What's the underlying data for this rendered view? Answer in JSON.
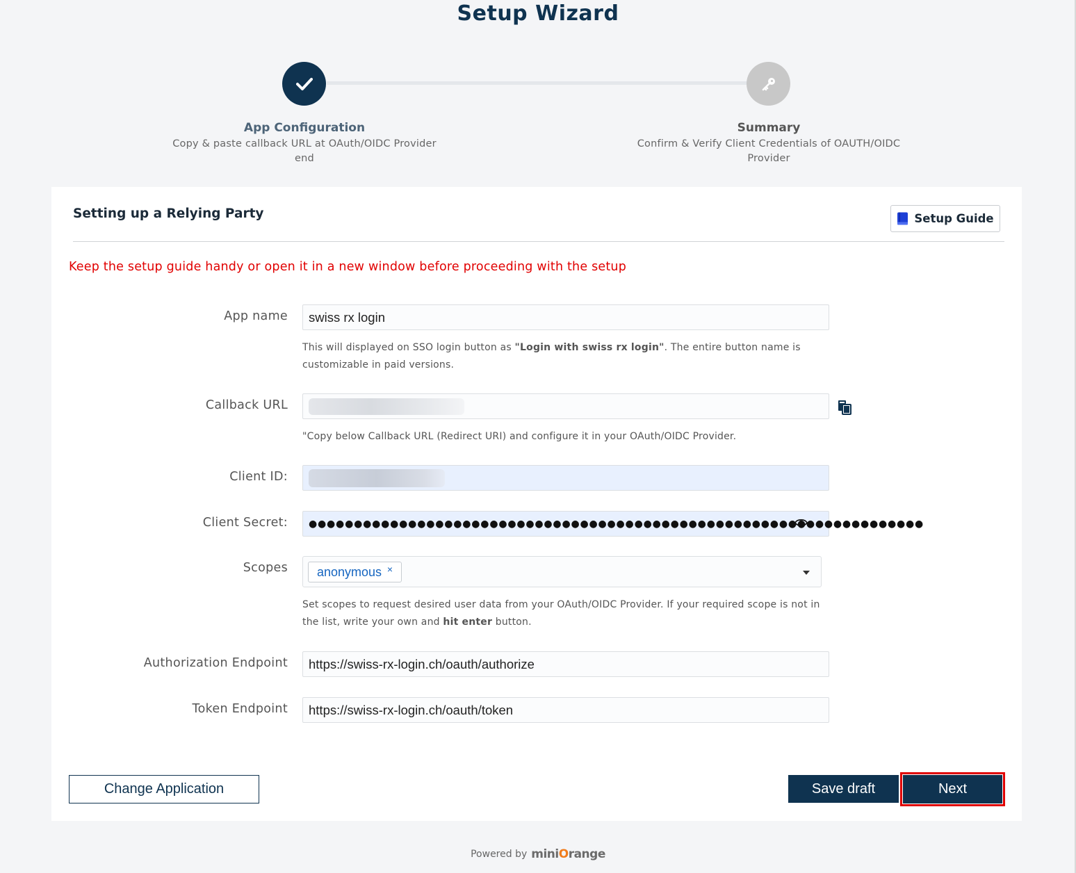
{
  "wizard": {
    "title": "Setup Wizard",
    "steps": [
      {
        "title": "App Configuration",
        "description": "Copy & paste callback URL at OAuth/OIDC Provider end",
        "status": "completed",
        "icon": "check-icon"
      },
      {
        "title": "Summary",
        "description": "Confirm & Verify Client Credentials of OAUTH/OIDC Provider",
        "status": "pending",
        "icon": "key-icon"
      }
    ]
  },
  "card": {
    "heading": "Setting up a Relying Party",
    "setup_guide_label": "Setup Guide",
    "warning": "Keep the setup guide handy or open it in a new window before proceeding with the setup"
  },
  "form": {
    "app_name": {
      "label": "App name",
      "value": "swiss rx login",
      "help_prefix": "This will displayed on SSO login button as ",
      "help_bold": "\"Login with swiss rx login\"",
      "help_suffix": ". The entire button name is customizable in paid versions."
    },
    "callback_url": {
      "label": "Callback URL",
      "help": "\"Copy below Callback URL (Redirect URI) and configure it in your OAuth/OIDC Provider."
    },
    "client_id": {
      "label": "Client ID:"
    },
    "client_secret": {
      "label": "Client Secret:",
      "masked_value": "●●●●●●●●●●●●●●●●●●●●●●●●●●●●●●●●●●●●●●●●●●●●●●●●●●●●●●●●●●●●●●●●●●●●"
    },
    "scopes": {
      "label": "Scopes",
      "selected": [
        "anonymous"
      ],
      "help_prefix": "Set scopes to request desired user data from your OAuth/OIDC Provider. If your required scope is not in the list, write your own and ",
      "help_bold": "hit enter",
      "help_suffix": " button."
    },
    "authorization_endpoint": {
      "label": "Authorization Endpoint",
      "value": "https://swiss-rx-login.ch/oauth/authorize"
    },
    "token_endpoint": {
      "label": "Token Endpoint",
      "value": "https://swiss-rx-login.ch/oauth/token"
    }
  },
  "actions": {
    "change_application": "Change Application",
    "save_draft": "Save draft",
    "next": "Next"
  },
  "footer": {
    "powered_by": "Powered by",
    "brand_prefix": "mini",
    "brand_o": "O",
    "brand_suffix": "range"
  },
  "colors": {
    "primary": "#0f3350",
    "warning": "#e10000",
    "highlight": "#e00000",
    "tag_text": "#1565c0",
    "brand_orange": "#f07c1c"
  }
}
